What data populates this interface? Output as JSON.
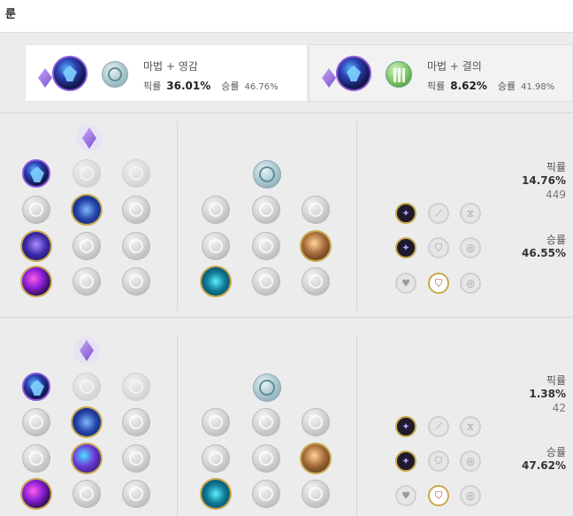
{
  "header": {
    "title": "룬"
  },
  "tabs": [
    {
      "name": "마법 + 영감",
      "pick_label": "픽률",
      "pick_value": "36.01%",
      "win_label": "승률",
      "win_value": "46.76%"
    },
    {
      "name": "마법 + 결의",
      "pick_label": "픽률",
      "pick_value": "8.62%",
      "win_label": "승률",
      "win_value": "41.98%"
    }
  ],
  "builds": [
    {
      "pick_label": "픽률",
      "pick_value": "14.76%",
      "count": "449",
      "win_label": "승률",
      "win_value": "46.55%"
    },
    {
      "pick_label": "픽률",
      "pick_value": "1.38%",
      "count": "42",
      "win_label": "승률",
      "win_value": "47.62%"
    }
  ],
  "colors": {
    "accent_gold": "#c9a94d",
    "sorcery_purple": "#8a56d6",
    "resolve_green": "#7cc45f",
    "inspiration_teal": "#a8c6cc"
  },
  "icons": {
    "keystone": "sorcery-keystone-icon",
    "sorcery": "sorcery-tree-icon",
    "inspiration": "inspiration-tree-icon",
    "resolve": "resolve-tree-icon"
  }
}
